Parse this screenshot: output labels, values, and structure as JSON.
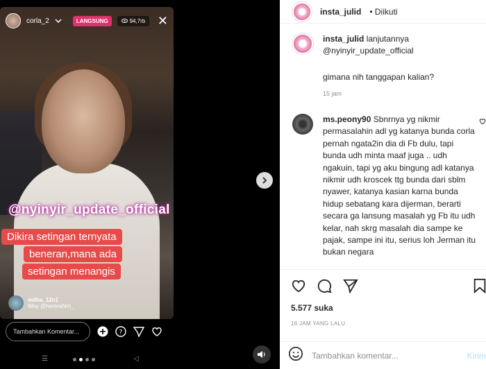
{
  "video": {
    "username": "corla_2",
    "live_label": "LANGSUNG",
    "viewers": "94,7rb",
    "watermark": "@nyinyir_update_official",
    "caption_lines": [
      "Dikira setingan ternyata",
      "beneran,mana ada",
      "setingan menangis"
    ],
    "overlay_comment": {
      "name": "mitha_12n1",
      "text": "Woy @hererahim_"
    },
    "add_comment_placeholder": "Tambahkan Komentar..."
  },
  "post": {
    "author": "insta_julid",
    "follow_status": "Diikuti",
    "caption_text": "lanjutannya",
    "caption_mention": "@nyinyir_update_official",
    "caption_question": "gimana nih tanggapan kalian?",
    "caption_time": "15 jam",
    "comment": {
      "user": "ms.peony90",
      "text": "Sbnrnya yg nikmir permasalahin adl yg katanya bunda corla pernah ngata2in dia di Fb dulu, tapi bunda udh minta maaf juga .. udh ngakuin, tapi yg aku bingung adl katanya nikmir udh kroscek ttg bunda dari sblm nyawer, katanya kasian karna bunda hidup sebatang kara dijerman, berarti secara ga lansung masalah yg Fb itu udh kelar, nah skrg masalah dia sampe ke pajak, sampe ini itu, serius loh Jerman itu bukan negara"
    },
    "likes": "5.577 suka",
    "date": "16 JAM YANG LALU",
    "add_comment_placeholder": "Tambahkan komentar...",
    "send_label": "Kirim"
  }
}
